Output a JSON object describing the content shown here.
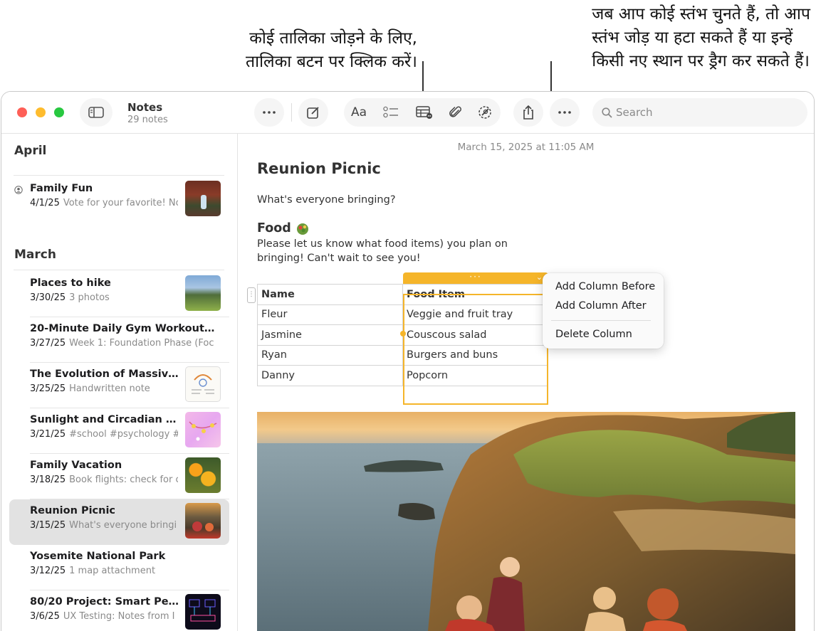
{
  "callouts": {
    "left": [
      "कोई तालिका जोड़ने के लिए,",
      "तालिका बटन पर क्लिक करें।"
    ],
    "right": [
      "जब आप कोई स्तंभ चुनते हैं, तो आप",
      "स्तंभ जोड़ या हटा सकते हैं या इन्हें",
      "किसी नए स्थान पर ड्रैग कर सकते हैं।"
    ]
  },
  "app": {
    "title": "Notes",
    "subtitle": "29 notes"
  },
  "toolbar": {
    "format_label": "Aa",
    "search_placeholder": "Search",
    "icons": [
      "sidebar-toggle-icon",
      "more-icon",
      "compose-icon",
      "format-text-icon",
      "checklist-icon",
      "table-icon",
      "attachment-icon",
      "collaborate-icon",
      "share-icon",
      "more-icon",
      "search-icon"
    ]
  },
  "sidebar": {
    "sections": [
      {
        "heading": "April",
        "notes": [
          {
            "title": "Family Fun",
            "date": "4/1/25",
            "preview": "Vote for your favorite! No",
            "shared": true,
            "thumb": "brick-wall-photo"
          }
        ]
      },
      {
        "heading": "March",
        "notes": [
          {
            "title": "Places to hike",
            "date": "3/30/25",
            "preview": "3 photos",
            "thumb": "mountain-photo"
          },
          {
            "title": "20-Minute Daily Gym Workout Pl...",
            "date": "3/27/25",
            "preview": "Week 1: Foundation Phase (Foc",
            "thumb": ""
          },
          {
            "title": "The Evolution of Massive...",
            "date": "3/25/25",
            "preview": "Handwritten note",
            "thumb": "handwritten-sketch"
          },
          {
            "title": "Sunlight and Circadian R...",
            "date": "3/21/25",
            "preview": "#school #psychology #",
            "thumb": "pink-diagram"
          },
          {
            "title": "Family Vacation",
            "date": "3/18/25",
            "preview": "Book flights: check for c",
            "thumb": "orange-flowers-photo"
          },
          {
            "title": "Reunion Picnic",
            "date": "3/15/25",
            "preview": "What's everyone bringi",
            "thumb": "picnic-photo",
            "selected": true
          },
          {
            "title": "Yosemite National Park",
            "date": "3/12/25",
            "preview": "1 map attachment",
            "thumb": ""
          },
          {
            "title": "80/20 Project: Smart Pet...",
            "date": "3/6/25",
            "preview": "UX Testing: Notes from I",
            "thumb": "dark-wireframe"
          }
        ]
      }
    ]
  },
  "editor": {
    "timestamp": "March 15, 2025 at 11:05 AM",
    "title": "Reunion Picnic",
    "intro": "What's everyone bringing?",
    "section_heading": "Food",
    "paragraph": "Please let us know what food items) you plan on bringing! Can't wait to see you!",
    "table": {
      "headers": [
        "Name",
        "Food Item"
      ],
      "rows": [
        [
          "Fleur",
          "Veggie and fruit tray"
        ],
        [
          "Jasmine",
          "Couscous salad"
        ],
        [
          "Ryan",
          "Burgers and buns"
        ],
        [
          "Danny",
          "Popcorn"
        ]
      ],
      "selected_column": 1
    },
    "column_handle_label": "···",
    "context_menu": {
      "items": [
        "Add Column Before",
        "Add Column After",
        "Delete Column"
      ]
    },
    "photo": "coastal-cliff-family-photo"
  },
  "colors": {
    "accent": "#f5b52a",
    "selected_row": "#e2e2e2",
    "close": "#fe5f57",
    "minimize": "#febc2e",
    "zoom": "#28c840"
  }
}
